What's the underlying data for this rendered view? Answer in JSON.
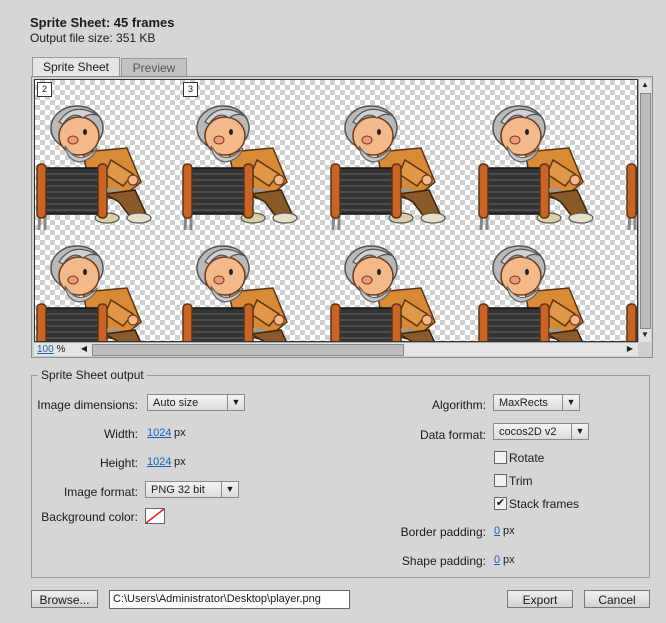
{
  "header": {
    "title": "Sprite Sheet: 45 frames",
    "subtitle": "Output file size: 351 KB"
  },
  "tabs": [
    {
      "label": "Sprite Sheet",
      "active": true
    },
    {
      "label": "Preview",
      "active": false
    }
  ],
  "canvas": {
    "frame_labels": [
      "2",
      "3"
    ],
    "zoom_value": "100",
    "zoom_unit": "%"
  },
  "output": {
    "legend": "Sprite Sheet output",
    "image_dimensions": {
      "label": "Image dimensions:",
      "value": "Auto size"
    },
    "width": {
      "label": "Width:",
      "value": "1024",
      "unit": "px"
    },
    "height": {
      "label": "Height:",
      "value": "1024",
      "unit": "px"
    },
    "image_format": {
      "label": "Image format:",
      "value": "PNG 32 bit"
    },
    "background_color": {
      "label": "Background color:"
    },
    "algorithm": {
      "label": "Algorithm:",
      "value": "MaxRects"
    },
    "data_format": {
      "label": "Data format:",
      "value": "cocos2D v2"
    },
    "rotate": {
      "label": "Rotate",
      "checked": false
    },
    "trim": {
      "label": "Trim",
      "checked": false
    },
    "stack_frames": {
      "label": "Stack frames",
      "checked": true
    },
    "border_padding": {
      "label": "Border padding:",
      "value": "0",
      "unit": "px"
    },
    "shape_padding": {
      "label": "Shape padding:",
      "value": "0",
      "unit": "px"
    }
  },
  "footer": {
    "browse_label": "Browse...",
    "path_value": "C:\\Users\\Administrator\\Desktop\\player.png",
    "export_label": "Export",
    "cancel_label": "Cancel"
  },
  "icons": {
    "dropdown_arrow": "▼",
    "check_mark": "✔",
    "scroll_left": "◀",
    "scroll_right": "▶",
    "scroll_up": "▲",
    "scroll_down": "▼"
  },
  "colors": {
    "link_blue": "#1a5fb4",
    "background_swatch_slash": "#e02020",
    "sprite_coat": "#d98a36",
    "sprite_skin": "#f3b98a",
    "sprite_hair": "#b9b9b9",
    "sprite_reel": "#333333"
  }
}
